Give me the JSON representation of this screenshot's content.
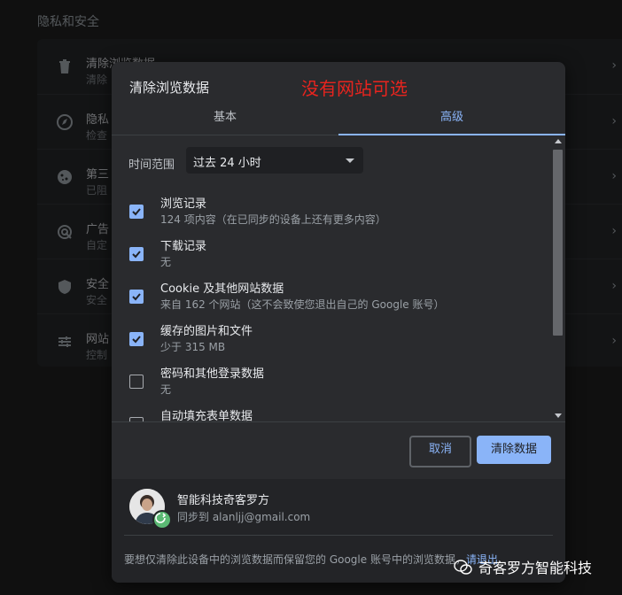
{
  "background": {
    "section_title": "隐私和安全",
    "rows": [
      {
        "label": "清除浏览数据",
        "sub": "清除"
      },
      {
        "label": "隐私",
        "sub": "检查"
      },
      {
        "label": "第三",
        "sub": "已阻"
      },
      {
        "label": "广告",
        "sub": "自定"
      },
      {
        "label": "安全",
        "sub": "安全"
      },
      {
        "label": "网站",
        "sub": "控制"
      }
    ]
  },
  "dialog": {
    "title": "清除浏览数据",
    "annotation": "没有网站可选",
    "annotation_color": "#e8241e",
    "tabs": [
      {
        "label": "基本"
      },
      {
        "label": "高级"
      }
    ],
    "time_range": {
      "label": "时间范围",
      "value": "过去 24 小时"
    },
    "options": [
      {
        "label": "浏览记录",
        "sub": "124 项内容（在已同步的设备上还有更多内容）",
        "checked": true
      },
      {
        "label": "下载记录",
        "sub": "无",
        "checked": true
      },
      {
        "label": "Cookie 及其他网站数据",
        "sub": "来自 162 个网站（这不会致使您退出自己的 Google 账号）",
        "checked": true
      },
      {
        "label": "缓存的图片和文件",
        "sub": "少于 315 MB",
        "checked": true
      },
      {
        "label": "密码和其他登录数据",
        "sub": "无",
        "checked": false
      },
      {
        "label": "自动填充表单数据",
        "sub": "",
        "checked": false
      }
    ],
    "buttons": {
      "cancel": "取消",
      "clear": "清除数据"
    },
    "account": {
      "name": "智能科技奇客罗方",
      "email": "同步到 alanljj@gmail.com",
      "note": "要想仅清除此设备中的浏览数据而保留您的 Google 账号中的浏览数据，",
      "note_link": "请退出"
    }
  },
  "watermark": "奇客罗方智能科技",
  "colors": {
    "accent": "#8ab4f8",
    "dialog_bg": "#2a2b2e",
    "page_bg": "#1e1e1e"
  }
}
